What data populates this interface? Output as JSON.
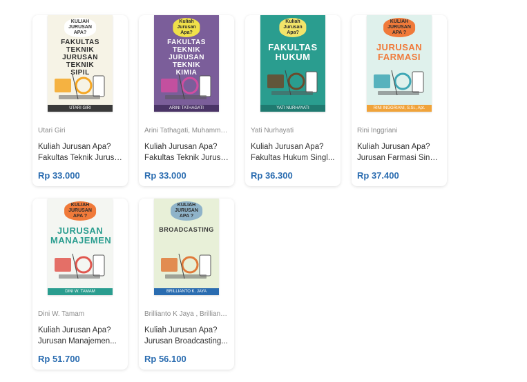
{
  "products": [
    {
      "author": "Utari Giri",
      "title_line1": "Kuliah Jurusan Apa?",
      "title_line2": "Fakultas Teknik Jurusa...",
      "price": "Rp 33.000",
      "cover": {
        "badge": "KULIAH\nJURUSAN\nAPA?",
        "title": "FAKULTAS TEKNIK\nJURUSAN\nTEKNIK\nSIPIL",
        "author": "UTARI GIRI",
        "bg": "#f6f3e6",
        "badge_bg": "#ffffff",
        "title_color": "#2b2b2b",
        "art": "#f5a623",
        "foot": "#3a3a3a"
      }
    },
    {
      "author": "Arini Tathagati, Muhamma...",
      "title_line1": "Kuliah Jurusan Apa?",
      "title_line2": "Fakultas Teknik Jurusa...",
      "price": "Rp 33.000",
      "cover": {
        "badge": "Kuliah\nJurusan\nApa?",
        "title": "FAKULTAS TEKNIK\nJURUSAN\nTEKNIK\nKIMIA",
        "author": "ARINI TATHAGATI",
        "bg": "#7b5e9a",
        "badge_bg": "#f0e04a",
        "title_color": "#ffffff",
        "art": "#d04ea0",
        "foot": "#4a3466"
      }
    },
    {
      "author": "Yati Nurhayati",
      "title_line1": "Kuliah Jurusan Apa?",
      "title_line2": "Fakultas Hukum Singl...",
      "price": "Rp 36.300",
      "cover": {
        "badge": "Kuliah\nJurusan\nApa?",
        "title": "FAKULTAS\nHUKUM",
        "author": "YATI NURHAYATI",
        "bg": "#2a9d8f",
        "badge_bg": "#f2e46a",
        "title_color": "#ffffff",
        "art": "#6b4a2b",
        "foot": "#1f7a70"
      }
    },
    {
      "author": "Rini Inggriani",
      "title_line1": "Kuliah Jurusan Apa?",
      "title_line2": "Jurusan Farmasi Singl...",
      "price": "Rp 37.400",
      "cover": {
        "badge": "KULIAH\nJURUSAN\nAPA ?",
        "title": "JURUSAN\nFARMASI",
        "author": "RINI INGGRIANI, S.Si., Apt.",
        "bg": "#dff1ec",
        "badge_bg": "#f07a3a",
        "title_color": "#f07a3a",
        "art": "#3fa7b5",
        "foot": "#f0a33a"
      }
    },
    {
      "author": "Dini W. Tamam",
      "title_line1": "Kuliah Jurusan Apa?",
      "title_line2": "Jurusan Manajemen...",
      "price": "Rp 51.700",
      "cover": {
        "badge": "KULIAH\nJURUSAN\nAPA ?",
        "title": "JURUSAN\nMANAJEMEN",
        "author": "DINI W. TAMAM",
        "bg": "#f4f6f2",
        "badge_bg": "#f07a3a",
        "title_color": "#2a9d8f",
        "art": "#e0574f",
        "foot": "#2a9d8f"
      }
    },
    {
      "author": "Brillianto K Jaya , Brillianto...",
      "title_line1": "Kuliah Jurusan Apa?",
      "title_line2": "Jurusan Broadcasting...",
      "price": "Rp 56.100",
      "cover": {
        "badge": "KULIAH\nJURUSAN\nAPA ?",
        "title": "BROADCASTING",
        "author": "BRILLIANTO K. JAYA",
        "bg": "#e8f0d8",
        "badge_bg": "#8fb3c9",
        "title_color": "#3a3a3a",
        "art": "#e07a3a",
        "foot": "#2a6cb0"
      }
    }
  ]
}
